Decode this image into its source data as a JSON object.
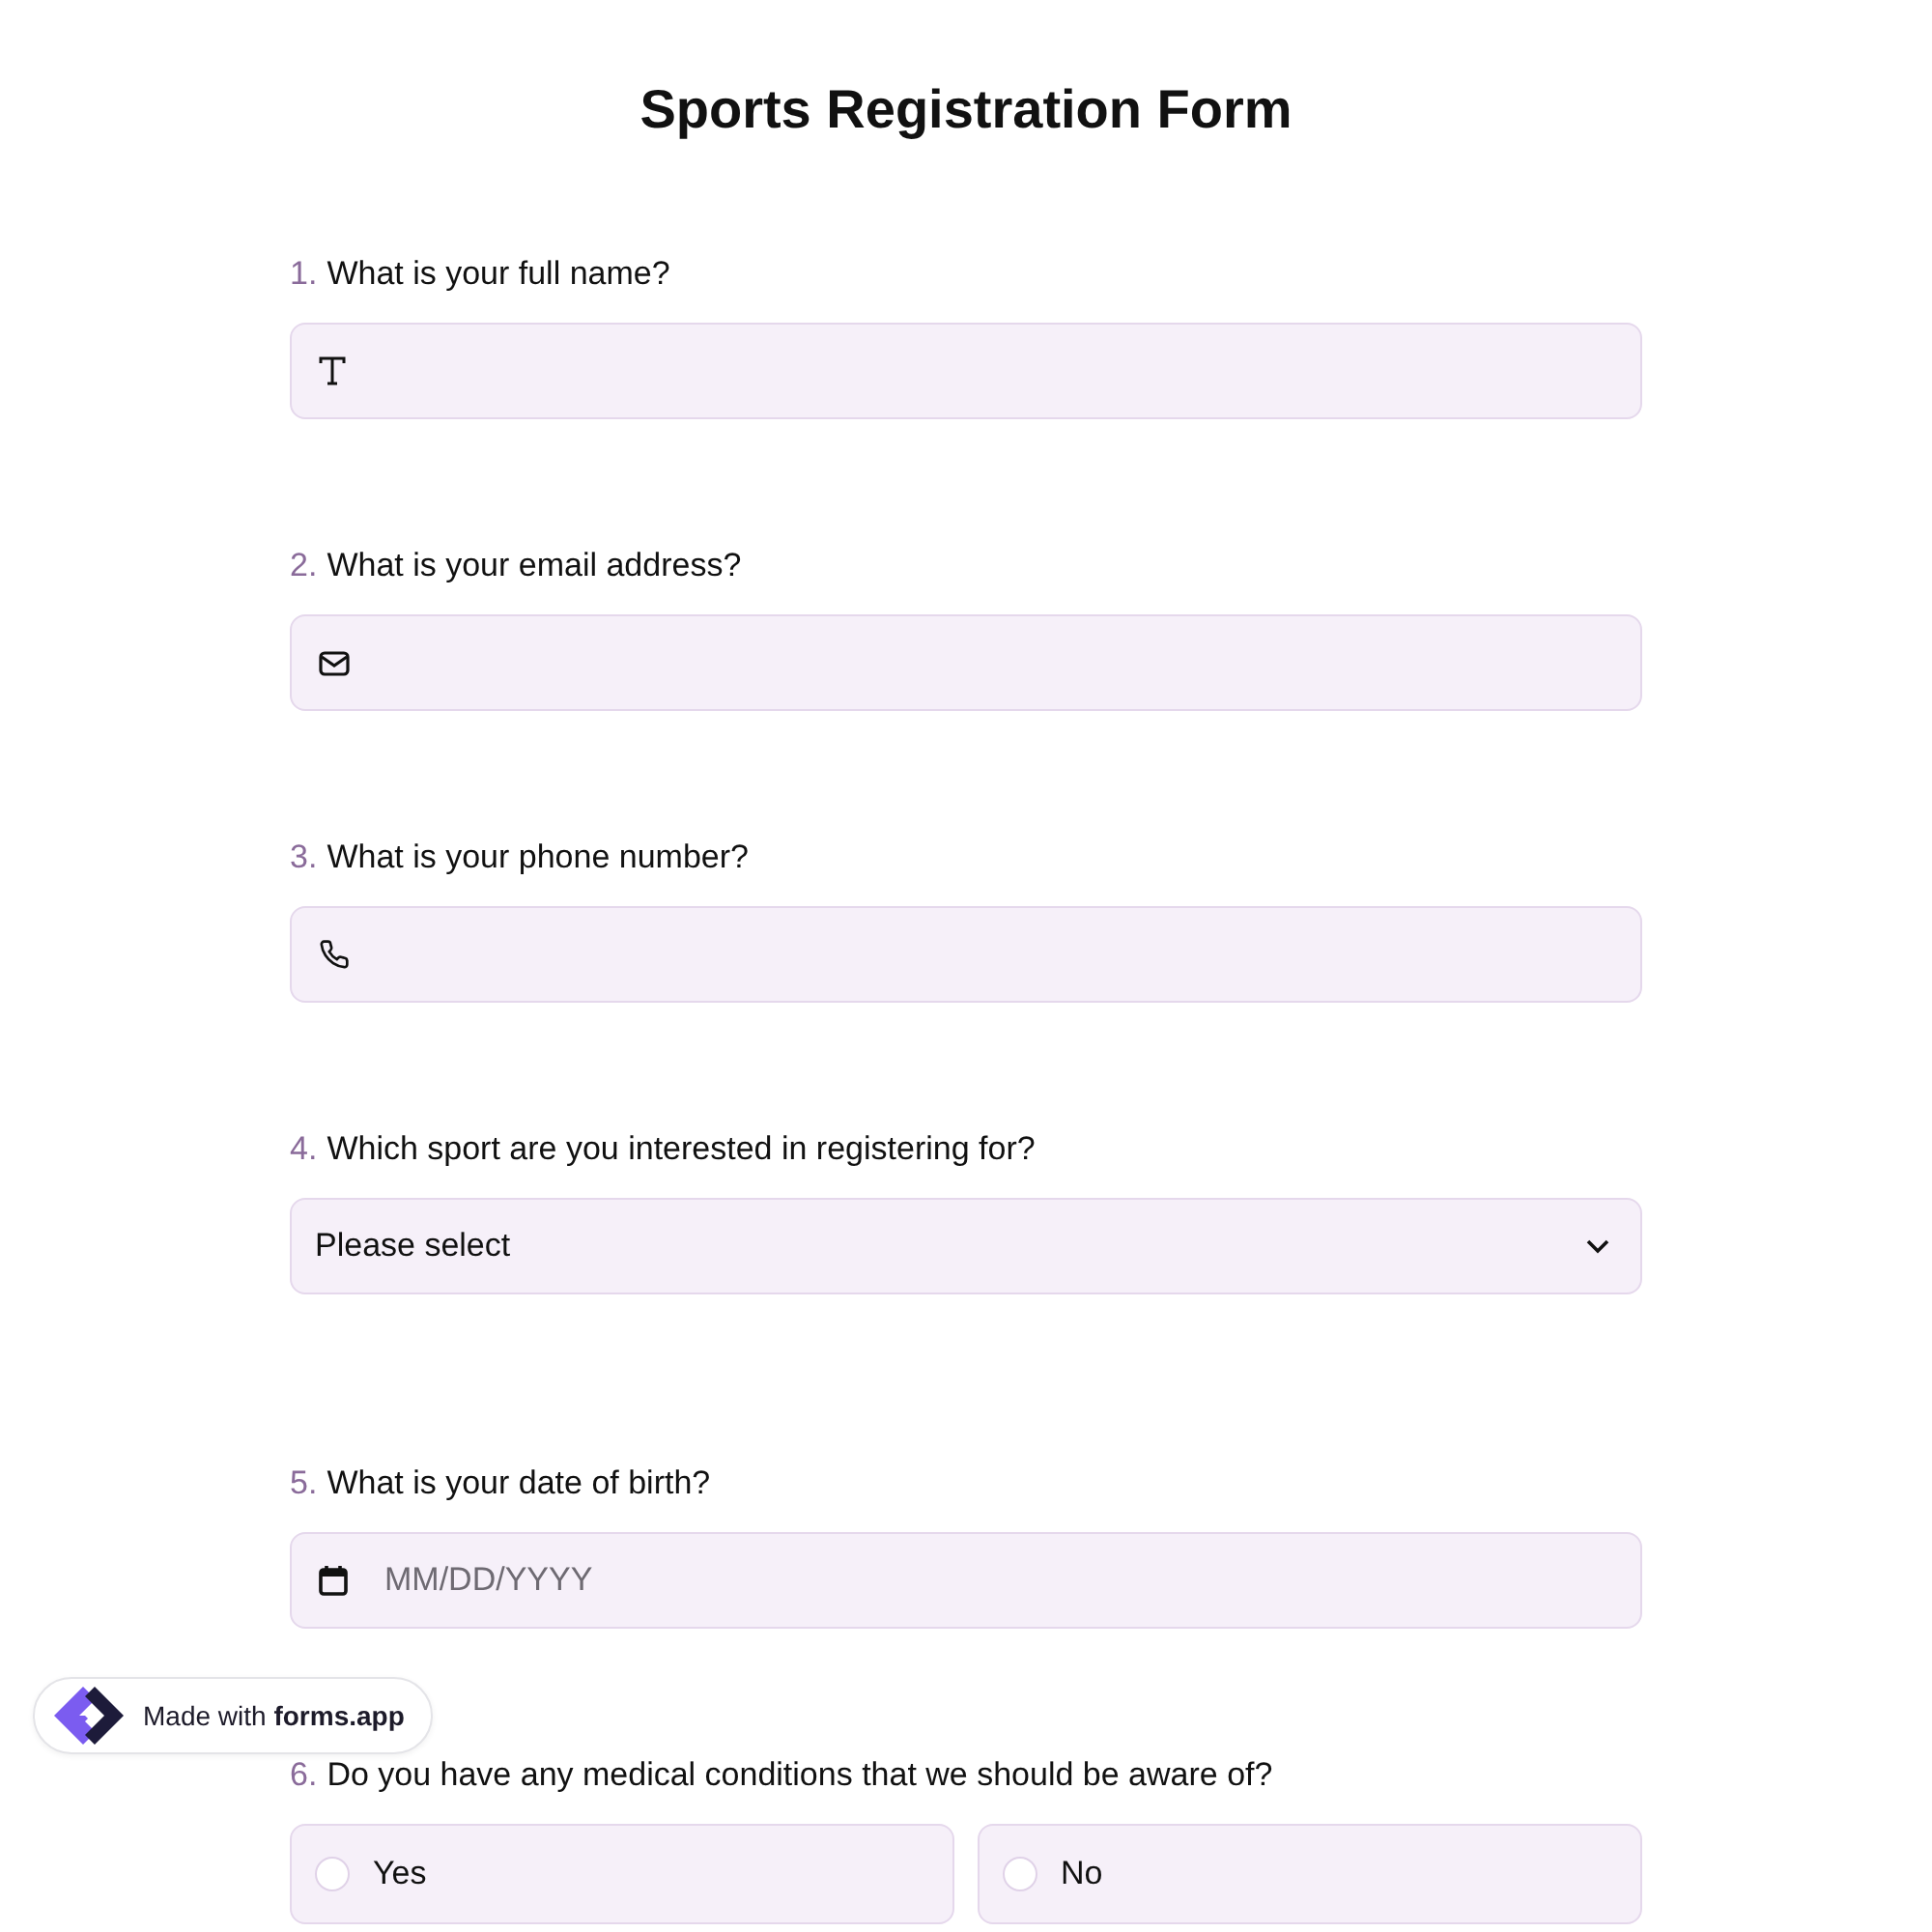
{
  "title": "Sports Registration Form",
  "questions": [
    {
      "kind": "text",
      "number": "1.",
      "label": "What is your full name?"
    },
    {
      "kind": "email",
      "number": "2.",
      "label": "What is your email address?"
    },
    {
      "kind": "phone",
      "number": "3.",
      "label": "What is your phone number?"
    },
    {
      "kind": "select",
      "number": "4.",
      "label": "Which sport are you interested in registering for?",
      "value": "Please select"
    },
    {
      "kind": "date",
      "number": "5.",
      "label": "What is your date of birth?",
      "placeholder": "MM/DD/YYYY"
    },
    {
      "kind": "radio",
      "number": "6.",
      "label": "Do you have any medical conditions that we should be aware of?",
      "options": [
        {
          "label": "Yes",
          "selected": false
        },
        {
          "label": "No",
          "selected": false
        }
      ]
    }
  ],
  "badge": {
    "text": "Made with **forms.app**"
  }
}
